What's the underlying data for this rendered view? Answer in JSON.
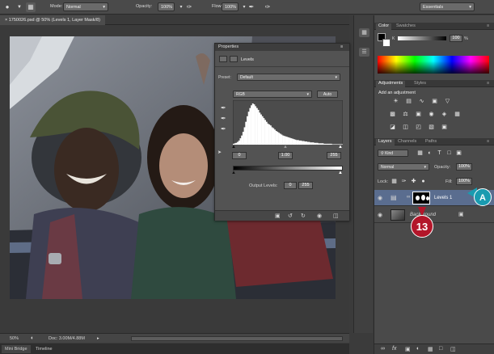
{
  "options_bar": {
    "mode_label": "Mode:",
    "mode_value": "Normal",
    "opacity_label": "Opacity:",
    "opacity_value": "100%",
    "flow_label": "Flow:",
    "flow_value": "100%",
    "workspace_value": "Essentials"
  },
  "document": {
    "tab_title": "1750026.psd @ 50% (Levels 1, Layer Mask/8)",
    "close_glyph": "×",
    "zoom": "50%",
    "doc_size": "Doc: 3.00M/4.88M"
  },
  "bottom_tabs": [
    "Mini Bridge",
    "Timeline"
  ],
  "properties": {
    "tab": "Properties",
    "title": "Levels",
    "preset_label": "Preset:",
    "preset_value": "Default",
    "channel_value": "RGB",
    "auto_label": "Auto",
    "input_black": "0",
    "input_gray": "1.00",
    "input_white": "255",
    "output_label": "Output Levels:",
    "output_black": "0",
    "output_white": "255",
    "histogram": [
      2,
      3,
      4,
      6,
      9,
      14,
      20,
      28,
      38,
      50,
      62,
      72,
      80,
      86,
      90,
      88,
      84,
      80,
      76,
      70,
      66,
      62,
      58,
      54,
      50,
      46,
      44,
      42,
      38,
      36,
      33,
      30,
      28,
      26,
      24,
      22,
      20,
      19,
      18,
      17,
      16,
      15,
      14,
      13,
      12,
      11,
      10,
      10,
      9,
      9,
      8,
      8,
      7,
      7,
      6,
      6,
      5,
      5,
      5,
      4,
      4,
      4,
      3,
      3,
      3,
      3,
      2,
      2,
      2,
      2,
      2,
      2,
      1,
      1,
      1,
      1,
      1,
      1,
      1,
      1
    ]
  },
  "color_panel": {
    "tabs": [
      "Color",
      "Swatches"
    ],
    "k_value": "100",
    "percent": "%"
  },
  "adjustments_panel": {
    "tabs": [
      "Adjustments",
      "Styles"
    ],
    "heading": "Add an adjustment"
  },
  "layers_panel": {
    "tabs": [
      "Layers",
      "Channels",
      "Paths"
    ],
    "kind_value": "Kind",
    "blend_value": "Normal",
    "opacity_label": "Opacity:",
    "opacity_value": "100%",
    "lock_label": "Lock:",
    "fill_label": "Fill:",
    "fill_value": "100%",
    "layers": [
      {
        "name": "Levels 1"
      },
      {
        "name": "Background"
      }
    ]
  },
  "callouts": {
    "a_label": "A",
    "num_label": "13"
  },
  "colors": {
    "callout_teal": "#1a9bb0",
    "callout_red": "#b3162a",
    "selected_layer": "#5a6d8f"
  }
}
